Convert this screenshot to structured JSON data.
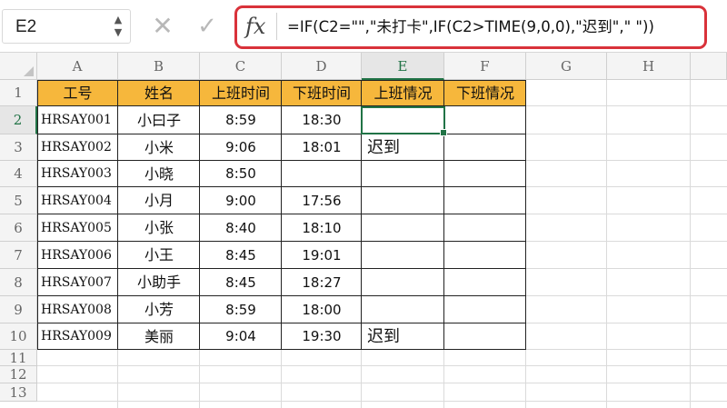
{
  "formula_bar": {
    "name_box": "E2",
    "formula": "=IF(C2=\"\",\"未打卡\",IF(C2>TIME(9,0,0),\"迟到\",\" \"))"
  },
  "columns": [
    "A",
    "B",
    "C",
    "D",
    "E",
    "F",
    "G",
    "H"
  ],
  "rows": [
    "1",
    "2",
    "3",
    "4",
    "5",
    "6",
    "7",
    "8",
    "9",
    "10",
    "11",
    "12",
    "13"
  ],
  "table": {
    "headers": [
      "工号",
      "姓名",
      "上班时间",
      "下班时间",
      "上班情况",
      "下班情况"
    ],
    "records": [
      [
        "HRSAY001",
        "小曰子",
        "8:59",
        "18:30",
        "",
        ""
      ],
      [
        "HRSAY002",
        "小米",
        "9:06",
        "18:01",
        "迟到",
        ""
      ],
      [
        "HRSAY003",
        "小晓",
        "8:50",
        "",
        "",
        ""
      ],
      [
        "HRSAY004",
        "小月",
        "9:00",
        "17:56",
        "",
        ""
      ],
      [
        "HRSAY005",
        "小张",
        "8:40",
        "18:10",
        "",
        ""
      ],
      [
        "HRSAY006",
        "小王",
        "8:45",
        "19:01",
        "",
        ""
      ],
      [
        "HRSAY007",
        "小助手",
        "8:45",
        "18:27",
        "",
        ""
      ],
      [
        "HRSAY008",
        "小芳",
        "8:59",
        "18:00",
        "",
        ""
      ],
      [
        "HRSAY009",
        "美丽",
        "9:04",
        "19:30",
        "迟到",
        ""
      ]
    ]
  },
  "colors": {
    "header_fill": "#f6b73c",
    "selection": "#217346",
    "formula_highlight": "#d9323a"
  },
  "icons": {
    "cancel": "close-icon",
    "enter": "check-icon",
    "function": "fx-icon"
  }
}
